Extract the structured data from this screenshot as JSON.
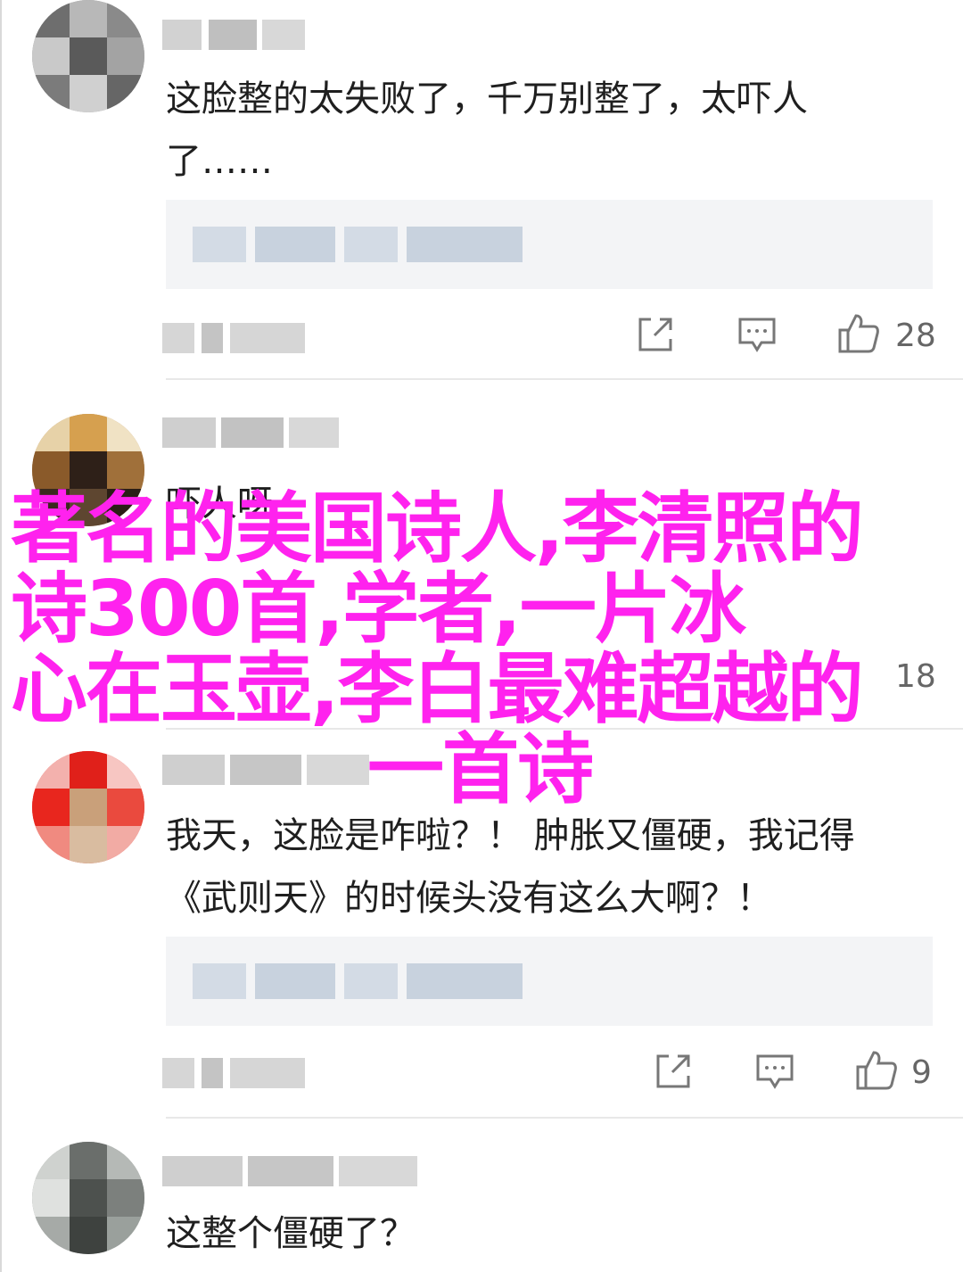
{
  "comments": [
    {
      "text": "这脸整的太失败了，千万别整了，太吓人\n了……",
      "like_count": "28"
    },
    {
      "text": "吓人呀",
      "like_count": "18"
    },
    {
      "text": "我天，这脸是咋啦？！ 肿胀又僵硬，我记得\n《武则天》的时候头没有这么大啊？！",
      "like_count": "9"
    },
    {
      "text": "这整个僵硬了？"
    }
  ],
  "icons": {
    "share": "share-icon",
    "reply": "comment-icon",
    "like": "thumbs-up-icon"
  },
  "watermark": {
    "line1": "著名的美国诗人,李清照的",
    "line2": "诗300首,学者,一片冰",
    "line3": "心在玉壶,李白最难超越的",
    "line4": "一首诗",
    "color": "#ff22ee"
  }
}
